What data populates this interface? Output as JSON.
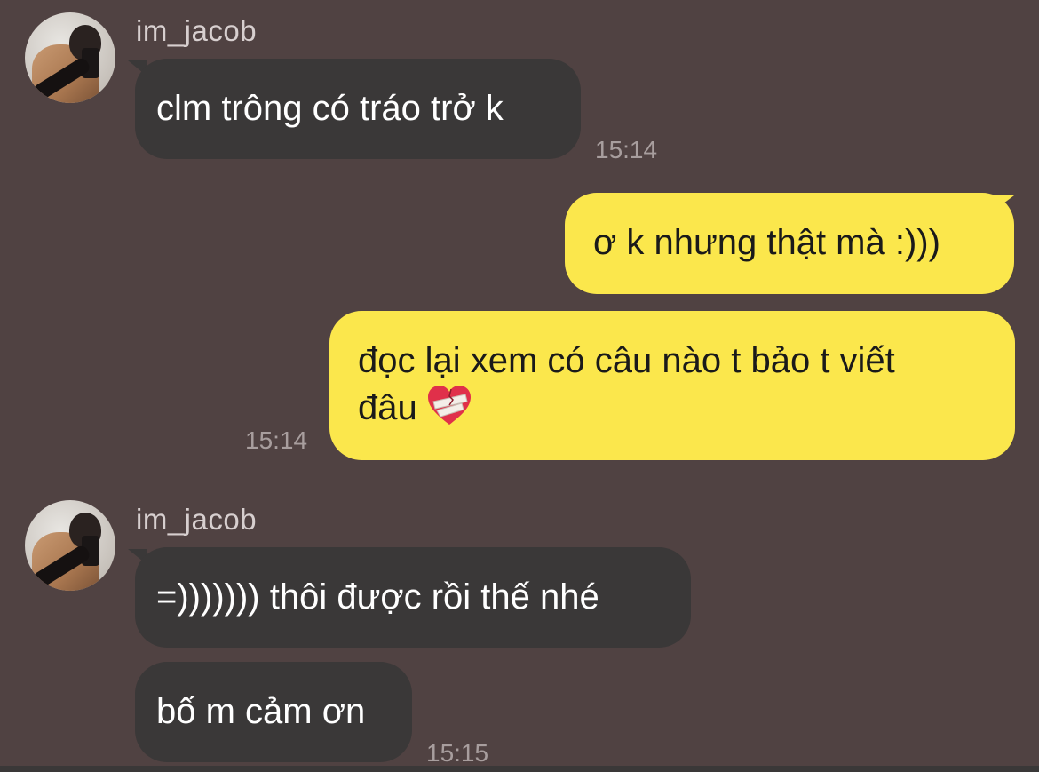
{
  "colors": {
    "background": "#504242",
    "incoming_bubble": "#3a3838",
    "outgoing_bubble": "#fbe74c",
    "timestamp": "#a89e9e",
    "username": "#d7cfcf"
  },
  "messages": {
    "group1": {
      "sender": "im_jacob",
      "avatar_icon": "profile-photo",
      "text": "clm trông có tráo trở k",
      "time": "15:14"
    },
    "out1": {
      "text": "ơ k nhưng thật mà :)))"
    },
    "out2": {
      "line1": "đọc lại xem có câu nào t bảo t viết",
      "line2": "đâu",
      "emoji_icon": "mending-heart-emoji",
      "time": "15:14"
    },
    "group2": {
      "sender": "im_jacob",
      "avatar_icon": "profile-photo",
      "text1": "=))))))) thôi được rồi thế nhé",
      "text2": "bố m cảm ơn",
      "time": "15:15"
    }
  }
}
